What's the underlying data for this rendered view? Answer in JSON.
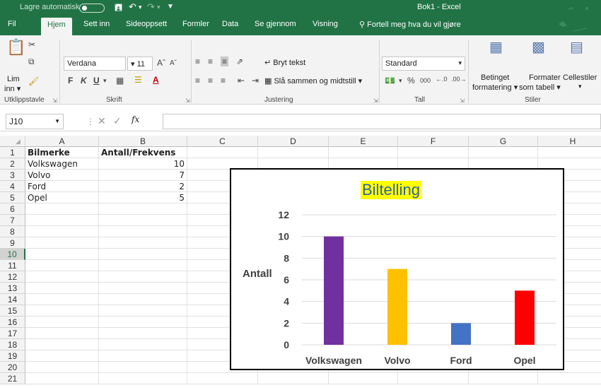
{
  "titlebar": {
    "autosave_label": "Lagre automatisk",
    "window_title": "Bok1  -  Excel"
  },
  "tabs": [
    {
      "label": "Fil",
      "active": false
    },
    {
      "label": "Hjem",
      "active": true
    },
    {
      "label": "Sett inn",
      "active": false
    },
    {
      "label": "Sideoppsett",
      "active": false
    },
    {
      "label": "Formler",
      "active": false
    },
    {
      "label": "Data",
      "active": false
    },
    {
      "label": "Se gjennom",
      "active": false
    },
    {
      "label": "Visning",
      "active": false
    }
  ],
  "tell_me": "Fortell meg hva du vil gjøre",
  "ribbon": {
    "clipboard": {
      "paste_label": "Lim",
      "paste_label2": "inn",
      "group": "Utklippstavle"
    },
    "font": {
      "name": "Verdana",
      "size": "11",
      "bold": "F",
      "italic": "K",
      "underline": "U",
      "group": "Skrift"
    },
    "alignment": {
      "wrap": "Bryt tekst",
      "merge": "Slå sammen og midtstill",
      "group": "Justering"
    },
    "number": {
      "format": "Standard",
      "percent": "%",
      "thousands": "000",
      "group": "Tall"
    },
    "styles": {
      "conditional": "Betinget",
      "conditional2": "formatering",
      "format_table": "Formater",
      "format_table2": "som tabell",
      "cell_styles": "Cellestiler",
      "group": "Stiler"
    }
  },
  "formula_bar": {
    "name_box": "J10",
    "fx": "fx",
    "value": ""
  },
  "columns": [
    "A",
    "B",
    "C",
    "D",
    "E",
    "F",
    "G",
    "H"
  ],
  "rows": [
    "1",
    "2",
    "3",
    "4",
    "5",
    "6",
    "7",
    "8",
    "9",
    "10",
    "11",
    "12",
    "13",
    "14",
    "15",
    "16",
    "17",
    "18",
    "19",
    "20",
    "21"
  ],
  "selected_row": "10",
  "sheet": {
    "header": {
      "a": "Bilmerke",
      "b": "Antall/Frekvens"
    },
    "data": [
      {
        "a": "Volkswagen",
        "b": "10"
      },
      {
        "a": "Volvo",
        "b": "7"
      },
      {
        "a": "Ford",
        "b": "2"
      },
      {
        "a": "Opel",
        "b": "5"
      }
    ]
  },
  "chart_data": {
    "type": "bar",
    "title": "Biltelling",
    "ylabel": "Antall",
    "xlabel": "",
    "categories": [
      "Volkswagen",
      "Volvo",
      "Ford",
      "Opel"
    ],
    "values": [
      10,
      7,
      2,
      5
    ],
    "colors": [
      "#7030a0",
      "#ffc000",
      "#4472c4",
      "#ff0000"
    ],
    "ylim": [
      0,
      12
    ],
    "yticks": [
      0,
      2,
      4,
      6,
      8,
      10,
      12
    ],
    "grid": true,
    "legend": "none"
  },
  "colors": {
    "excel_green": "#217346",
    "title_highlight": "#ffff00"
  }
}
